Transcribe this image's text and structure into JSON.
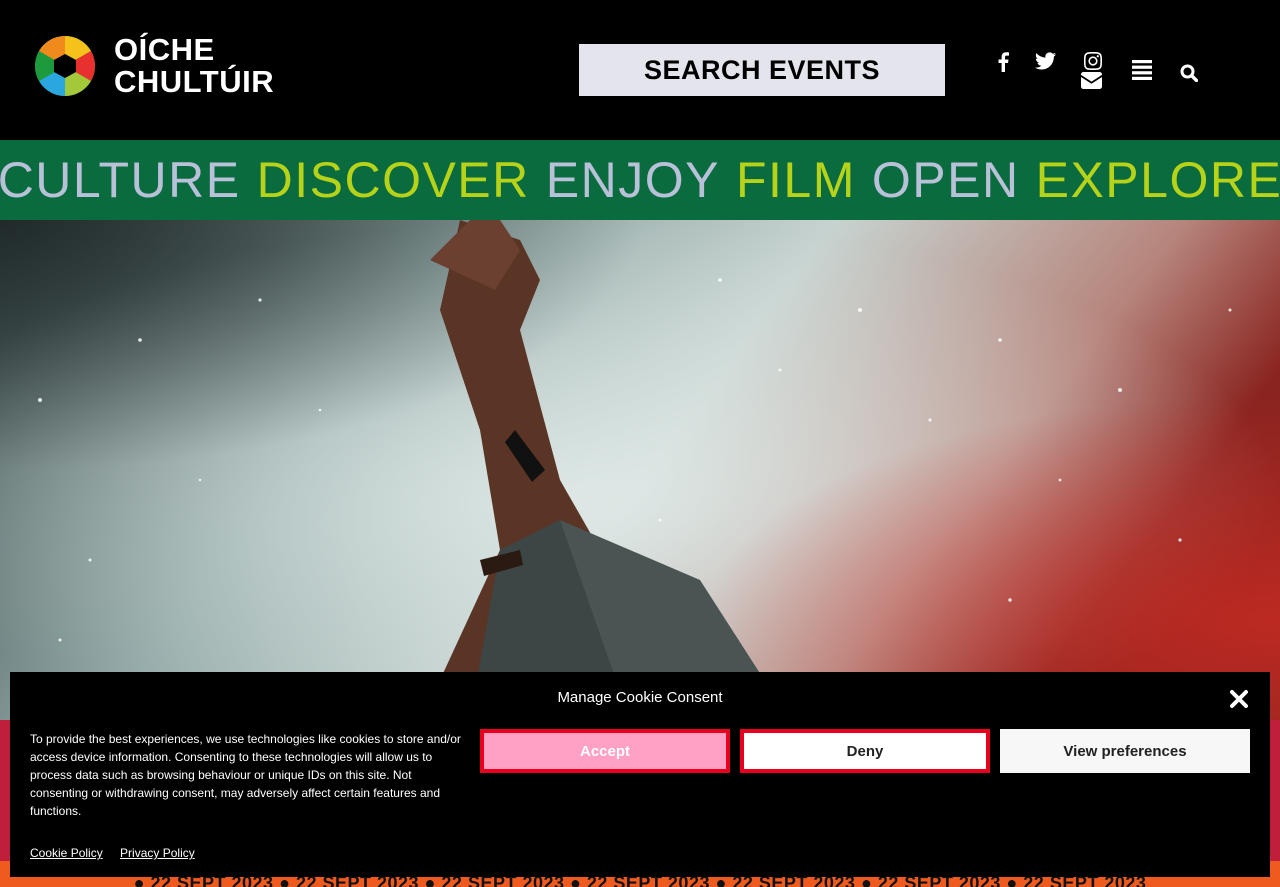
{
  "header": {
    "logo_line1": "OÍCHE",
    "logo_line2": "CHULTÚIR",
    "search_label": "SEARCH EVENTS"
  },
  "icons": {
    "facebook": "facebook-icon",
    "twitter": "twitter-icon",
    "instagram": "instagram-icon",
    "email": "envelope-icon",
    "menu": "menu-icon",
    "search": "search-icon"
  },
  "ticker": {
    "words": [
      "CULTURE",
      "DISCOVER",
      "ENJOY",
      "FILM",
      "OPEN",
      "EXPLORE"
    ],
    "colors": {
      "a": "#b9c1d9",
      "b": "#b6d31a",
      "background": "#0a6b3e"
    }
  },
  "dates": {
    "item": "● 22 SEPT 2023"
  },
  "cookie": {
    "title": "Manage Cookie Consent",
    "body": "To provide the best experiences, we use technologies like cookies to store and/or access device information. Consenting to these technologies will allow us to process data such as browsing behaviour or unique IDs on this site. Not consenting or withdrawing consent, may adversely affect certain features and functions.",
    "accept_label": "Accept",
    "deny_label": "Deny",
    "view_label": "View preferences",
    "cookie_policy": "Cookie Policy",
    "privacy_policy": "Privacy Policy"
  },
  "colors": {
    "accept_bg": "#ffa0c4",
    "button_border": "#e8001c",
    "red_strip": "#c01f3b",
    "orange_strip": "#ef5a1f"
  }
}
